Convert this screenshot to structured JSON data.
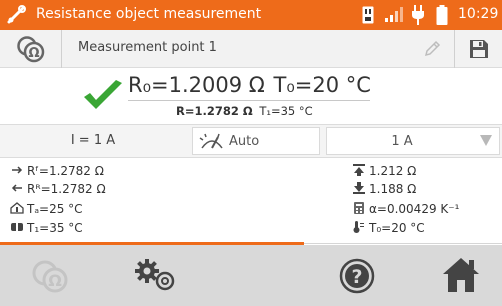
{
  "status_bar": {
    "title": "Resistance object measurement",
    "time": "10:29",
    "icons": [
      "measurement-tool-icon",
      "sd-card-icon",
      "signal-icon",
      "plug-icon",
      "battery-icon"
    ]
  },
  "measurement_point": {
    "name": "Measurement point 1",
    "icons": [
      "ohm-icon",
      "edit-icon",
      "save-icon"
    ]
  },
  "result": {
    "r0": "R₀=1.2009 Ω",
    "t0": "T₀=20 °C",
    "r_label": "R=1.2782 Ω",
    "t1_label": "T₁=35 °C"
  },
  "settings": {
    "current": "I = 1 A",
    "mode": "Auto",
    "range": "1 A"
  },
  "details": {
    "rf": "Rᶠ=1.2782 Ω",
    "rr": "Rᴿ=1.2782 Ω",
    "ta": "Tₐ=25 °C",
    "t1": "T₁=35 °C",
    "upper": "1.212 Ω",
    "lower": "1.188 Ω",
    "alpha": "α=0.00429 K⁻¹",
    "t0": "T₀=20 °C"
  },
  "bottom_bar": {
    "icons": [
      "ohm-measure-icon",
      "settings-gears-icon",
      "help-icon",
      "home-icon"
    ]
  },
  "colors": {
    "accent": "#ee6b1a",
    "check": "#3aa635",
    "toolbar": "#d9d9d9"
  }
}
